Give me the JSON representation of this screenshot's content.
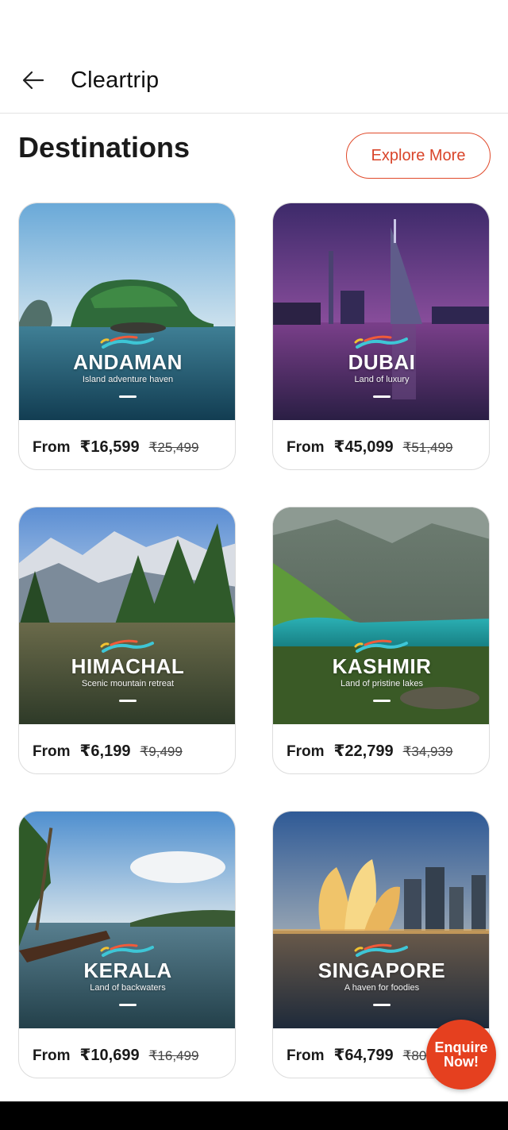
{
  "header": {
    "title": "Cleartrip",
    "back_icon": "arrow-left-icon"
  },
  "section": {
    "title": "Destinations",
    "explore_label": "Explore More"
  },
  "destinations": [
    {
      "name": "ANDAMAN",
      "tagline": "Island adventure haven",
      "from_label": "From",
      "price": "₹16,599",
      "old_price": "₹25,499"
    },
    {
      "name": "DUBAI",
      "tagline": "Land of luxury",
      "from_label": "From",
      "price": "₹45,099",
      "old_price": "₹51,499"
    },
    {
      "name": "HIMACHAL",
      "tagline": "Scenic mountain retreat",
      "from_label": "From",
      "price": "₹6,199",
      "old_price": "₹9,499"
    },
    {
      "name": "KASHMIR",
      "tagline": "Land of pristine lakes",
      "from_label": "From",
      "price": "₹22,799",
      "old_price": "₹34,939"
    },
    {
      "name": "KERALA",
      "tagline": "Land of backwaters",
      "from_label": "From",
      "price": "₹10,699",
      "old_price": "₹16,499"
    },
    {
      "name": "SINGAPORE",
      "tagline": "A haven for foodies",
      "from_label": "From",
      "price": "₹64,799",
      "old_price": "₹80"
    }
  ],
  "fab": {
    "line1": "Enquire",
    "line2": "Now!"
  },
  "colors": {
    "accent": "#e04a2b",
    "fab": "#e5401f"
  }
}
